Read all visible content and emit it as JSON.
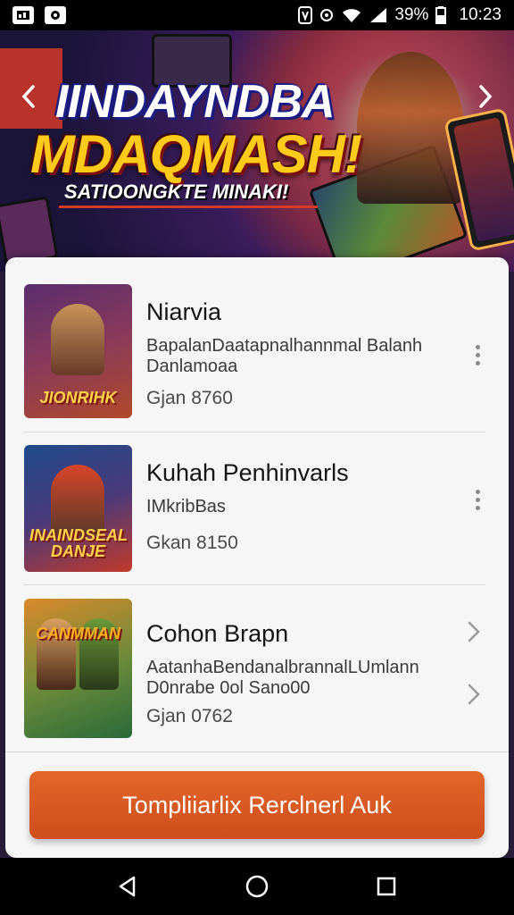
{
  "status_bar": {
    "battery_percent": "39%",
    "time": "10:23"
  },
  "banner": {
    "title_line1": "IINDAYNDBA",
    "title_line2": "MDAQMASH!",
    "subtitle": "SATIOONGKTE MINAKI!"
  },
  "games": [
    {
      "title": "Niarvia",
      "description": "BapalanDaatapnalhannmal Balanh Danlamoaa",
      "price": "Gjan 8760",
      "thumb_text": "JIONRIHK",
      "thumb_colors": [
        "#5a2d6e",
        "#b04a2a"
      ],
      "action": "more"
    },
    {
      "title": "Kuhah Penhinvarls",
      "description": "IMkribBas",
      "price": "Gkan 8150",
      "thumb_text": "INAINDSEAL DANJE",
      "thumb_colors": [
        "#1f4a8a",
        "#c23a2a"
      ],
      "action": "more"
    },
    {
      "title": "Cohon Brapn",
      "description": "AatanhaBendanalbrannalLUmlann D0nrabe 0ol Sano00",
      "price": "Gjan 0762",
      "thumb_text": "CANMMAN",
      "thumb_colors": [
        "#d98a2a",
        "#2a6a3a"
      ],
      "action": "chevron"
    }
  ],
  "cta": {
    "label": "Tompliiarlix Rerclnerl Auk"
  },
  "icons": {
    "back": "back-triangle-icon",
    "home": "home-circle-icon",
    "recents": "recents-square-icon"
  }
}
